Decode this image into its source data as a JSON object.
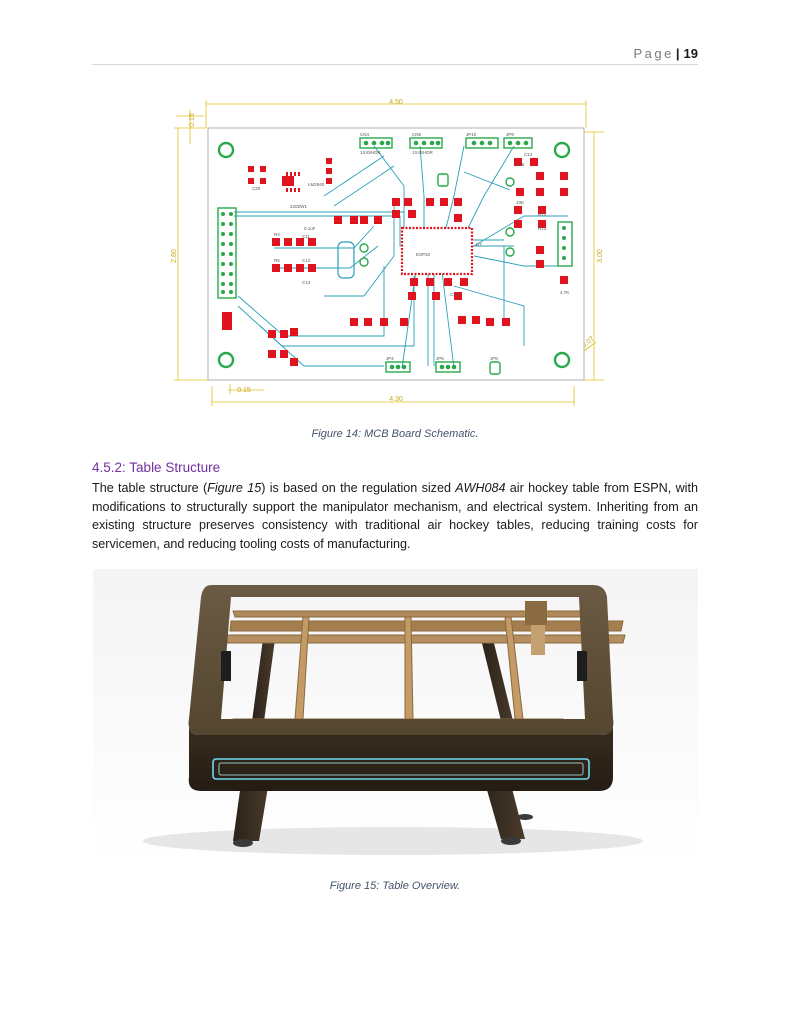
{
  "header": {
    "page_word": "Page",
    "separator": "|",
    "page_number": "19"
  },
  "figure14": {
    "caption": "Figure 14: MCB Board Schematic.",
    "dims": {
      "top_width": "4.50",
      "bottom_width": "4.30",
      "left_height": "2.80",
      "right_height": "3.00",
      "top_margin": "0.15",
      "bottom_margin": "0.15",
      "corner": "0.07"
    },
    "connector_labels": [
      "CN4",
      "CN6",
      "JP10",
      "JP9",
      "JP4",
      "JP5",
      "JP8"
    ],
    "net_labels": [
      "1X4SHDR",
      "1X4SHDR",
      "U7",
      "ESP32",
      "LM2940",
      "220ZW1",
      "C11",
      "C12",
      "C13",
      "C14",
      "C15",
      "C16",
      "C20",
      "R4",
      "R5",
      "R12",
      "R13",
      "10K",
      "4.7K",
      "0.1uF"
    ]
  },
  "section": {
    "number": "4.5.2:",
    "title": "Table Structure"
  },
  "paragraph": {
    "p1": "The table structure (",
    "fig_ref": "Figure 15",
    "p2": ") is based on the regulation sized ",
    "model": "AWH084",
    "p3": " air hockey table from ESPN, with modifications to structurally support the manipulator mechanism, and electrical system. Inheriting from an existing structure preserves consistency with traditional air hockey tables, reducing training costs for servicemen, and reducing tooling costs of manufacturing."
  },
  "figure15": {
    "caption": "Figure 15: Table Overview."
  },
  "colors": {
    "heading": "#7030a0",
    "caption": "#44546a",
    "pcb_trace": "#2aa0b8",
    "pcb_pad": "#e0141e",
    "dimension": "#e0c020",
    "table_frame": "#4a3c2a",
    "table_wood": "#b08a5a",
    "table_led": "#6fd8ee"
  }
}
